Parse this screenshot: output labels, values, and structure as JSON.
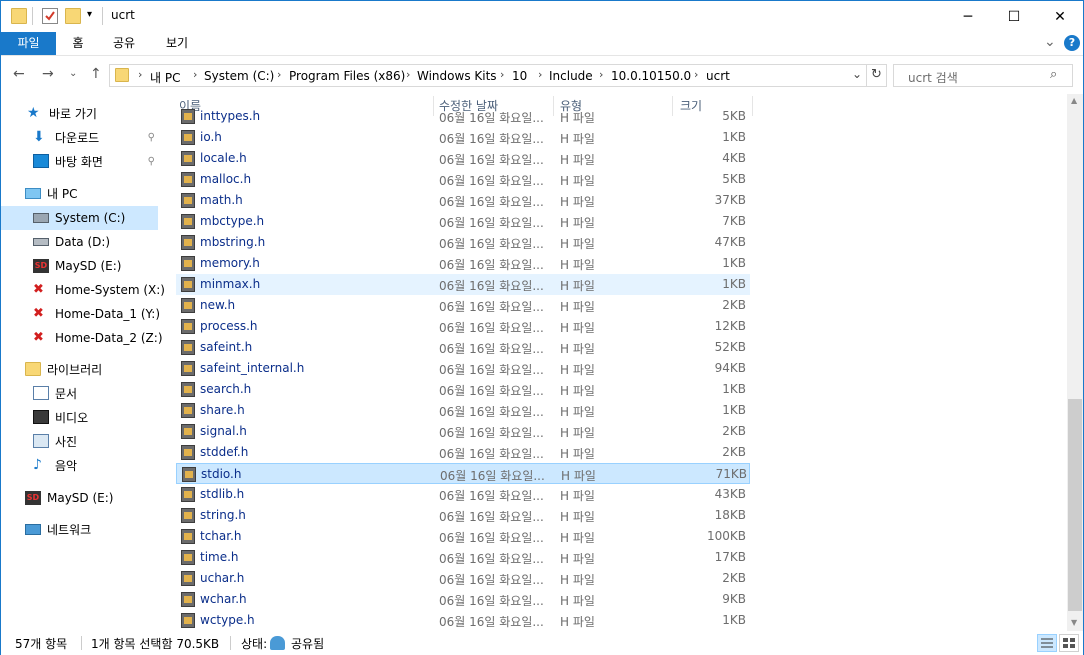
{
  "window": {
    "title": "ucrt",
    "controls": {
      "minimize": "─",
      "maximize": "☐",
      "close": "✕"
    }
  },
  "ribbon": {
    "tabs": [
      "파일",
      "홈",
      "공유",
      "보기"
    ],
    "expand_glyph": "⌄",
    "help_glyph": "?"
  },
  "address": {
    "breadcrumbs": [
      "내 PC",
      "System (C:)",
      "Program Files (x86)",
      "Windows Kits",
      "10",
      "Include",
      "10.0.10150.0",
      "ucrt"
    ],
    "search_placeholder": "ucrt 검색"
  },
  "nav": {
    "quick_access": "바로 가기",
    "pinned": [
      "다운로드",
      "바탕 화면"
    ],
    "this_pc": "내 PC",
    "drives": [
      "System (C:)",
      "Data (D:)",
      "MaySD (E:)",
      "Home-System (X:)",
      "Home-Data_1 (Y:)",
      "Home-Data_2 (Z:)"
    ],
    "libraries": "라이브러리",
    "library_items": [
      "문서",
      "비디오",
      "사진",
      "음악"
    ],
    "removable": "MaySD (E:)",
    "network": "네트워크"
  },
  "columns": {
    "name": "이름",
    "date": "수정한 날짜",
    "type": "유형",
    "size": "크기"
  },
  "files": [
    {
      "name": "inttypes.h",
      "date": "06월 16일 화요일...",
      "type": "H 파일",
      "size": "5KB"
    },
    {
      "name": "io.h",
      "date": "06월 16일 화요일...",
      "type": "H 파일",
      "size": "1KB"
    },
    {
      "name": "locale.h",
      "date": "06월 16일 화요일...",
      "type": "H 파일",
      "size": "4KB"
    },
    {
      "name": "malloc.h",
      "date": "06월 16일 화요일...",
      "type": "H 파일",
      "size": "5KB"
    },
    {
      "name": "math.h",
      "date": "06월 16일 화요일...",
      "type": "H 파일",
      "size": "37KB"
    },
    {
      "name": "mbctype.h",
      "date": "06월 16일 화요일...",
      "type": "H 파일",
      "size": "7KB"
    },
    {
      "name": "mbstring.h",
      "date": "06월 16일 화요일...",
      "type": "H 파일",
      "size": "47KB"
    },
    {
      "name": "memory.h",
      "date": "06월 16일 화요일...",
      "type": "H 파일",
      "size": "1KB"
    },
    {
      "name": "minmax.h",
      "date": "06월 16일 화요일...",
      "type": "H 파일",
      "size": "1KB"
    },
    {
      "name": "new.h",
      "date": "06월 16일 화요일...",
      "type": "H 파일",
      "size": "2KB"
    },
    {
      "name": "process.h",
      "date": "06월 16일 화요일...",
      "type": "H 파일",
      "size": "12KB"
    },
    {
      "name": "safeint.h",
      "date": "06월 16일 화요일...",
      "type": "H 파일",
      "size": "52KB"
    },
    {
      "name": "safeint_internal.h",
      "date": "06월 16일 화요일...",
      "type": "H 파일",
      "size": "94KB"
    },
    {
      "name": "search.h",
      "date": "06월 16일 화요일...",
      "type": "H 파일",
      "size": "1KB"
    },
    {
      "name": "share.h",
      "date": "06월 16일 화요일...",
      "type": "H 파일",
      "size": "1KB"
    },
    {
      "name": "signal.h",
      "date": "06월 16일 화요일...",
      "type": "H 파일",
      "size": "2KB"
    },
    {
      "name": "stddef.h",
      "date": "06월 16일 화요일...",
      "type": "H 파일",
      "size": "2KB"
    },
    {
      "name": "stdio.h",
      "date": "06월 16일 화요일...",
      "type": "H 파일",
      "size": "71KB"
    },
    {
      "name": "stdlib.h",
      "date": "06월 16일 화요일...",
      "type": "H 파일",
      "size": "43KB"
    },
    {
      "name": "string.h",
      "date": "06월 16일 화요일...",
      "type": "H 파일",
      "size": "18KB"
    },
    {
      "name": "tchar.h",
      "date": "06월 16일 화요일...",
      "type": "H 파일",
      "size": "100KB"
    },
    {
      "name": "time.h",
      "date": "06월 16일 화요일...",
      "type": "H 파일",
      "size": "17KB"
    },
    {
      "name": "uchar.h",
      "date": "06월 16일 화요일...",
      "type": "H 파일",
      "size": "2KB"
    },
    {
      "name": "wchar.h",
      "date": "06월 16일 화요일...",
      "type": "H 파일",
      "size": "9KB"
    },
    {
      "name": "wctype.h",
      "date": "06월 16일 화요일...",
      "type": "H 파일",
      "size": "1KB"
    }
  ],
  "selected_file": "stdio.h",
  "hovered_file": "minmax.h",
  "status": {
    "item_count": "57개 항목",
    "selection": "1개 항목 선택함 70.5KB",
    "state_label": "상태:",
    "state_value": "공유됨"
  },
  "colors": {
    "accent": "#1979ca",
    "selected_bg": "#cce8ff",
    "hover_bg": "#e5f3ff",
    "folder": "#f8d775"
  }
}
